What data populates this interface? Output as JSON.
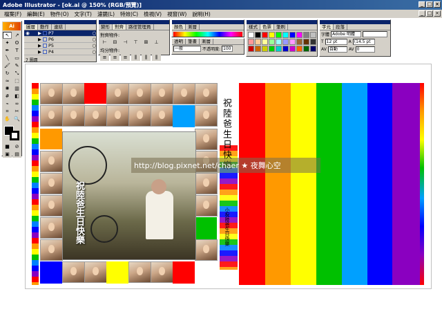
{
  "window": {
    "title": "Adobe Illustrator - [ok.ai @ 150% (RGB/預覽)]"
  },
  "menu": {
    "items": [
      "檔案(F)",
      "編輯(E)",
      "物件(O)",
      "文字(T)",
      "濾鏡(L)",
      "特效(C)",
      "檢視(V)",
      "視窗(W)",
      "說明(H)"
    ]
  },
  "layers_panel": {
    "tabs": [
      "圖層",
      "動作",
      "連結"
    ],
    "rows": [
      {
        "name": "P7",
        "selected": true
      },
      {
        "name": "P6",
        "selected": false
      },
      {
        "name": "P5",
        "selected": false
      },
      {
        "name": "P4",
        "selected": false
      }
    ],
    "footer": "7 圖層"
  },
  "align_panel": {
    "tabs": [
      "變形",
      "對齊",
      "路徑管理員"
    ],
    "label1": "對齊物件:",
    "label2": "均分物件:"
  },
  "color_panel": {
    "tabs": [
      "顏色",
      "漸層"
    ]
  },
  "stroke_panel": {
    "tabs": [
      "透明",
      "筆畫",
      "漸層"
    ],
    "mode": "一般",
    "opacity_label": "不透明度:",
    "opacity": "100"
  },
  "swatches_panel": {
    "tabs": [
      "樣式",
      "色票",
      "筆刷"
    ]
  },
  "char_panel": {
    "tabs": [
      "字元",
      "段落"
    ],
    "font_label": "字體",
    "font": "Adobe 明體",
    "size": "12 pt",
    "leading": "(14.5 pt",
    "tracking_label": "自動",
    "kern": "0"
  },
  "artwork": {
    "vertical_title": "祝陸爸生日快樂",
    "side_title": "祝陸爸生日快樂",
    "side_small": "小祝陸爸生日快樂",
    "watermark": "http://blog.pixnet.net/chaer ★ 夜舞心空"
  },
  "colors": {
    "red": "#ff0000",
    "orange": "#ff9900",
    "yellow": "#ffff00",
    "green": "#00c000",
    "sky": "#00a0ff",
    "blue": "#0000ff",
    "purple": "#8a00c0"
  }
}
